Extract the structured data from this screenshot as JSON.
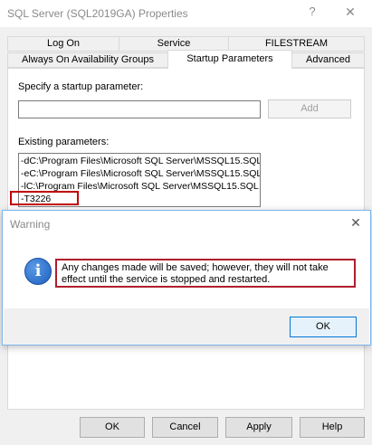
{
  "window": {
    "title": "SQL Server (SQL2019GA) Properties",
    "help_glyph": "?",
    "close_glyph": "✕"
  },
  "tabs": [
    {
      "label": "Log On"
    },
    {
      "label": "Service"
    },
    {
      "label": "FILESTREAM"
    },
    {
      "label": "Always On Availability Groups"
    },
    {
      "label": "Startup Parameters",
      "active": true
    },
    {
      "label": "Advanced"
    }
  ],
  "startup": {
    "specify_label": "Specify a startup parameter:",
    "input_value": "",
    "add_label": "Add",
    "existing_label": "Existing parameters:",
    "parameters": [
      "-dC:\\Program Files\\Microsoft SQL Server\\MSSQL15.SQL",
      "-eC:\\Program Files\\Microsoft SQL Server\\MSSQL15.SQL",
      "-lC:\\Program Files\\Microsoft SQL Server\\MSSQL15.SQL",
      "-T3226"
    ]
  },
  "buttons": {
    "ok": "OK",
    "cancel": "Cancel",
    "apply": "Apply",
    "help": "Help"
  },
  "warning": {
    "title": "Warning",
    "close_glyph": "✕",
    "icon": "info-icon",
    "icon_glyph": "i",
    "message": "Any changes made will be saved; however, they will not take effect until the service is stopped and restarted.",
    "ok_label": "OK"
  },
  "colors": {
    "highlight": "#c00000",
    "info_blue": "#1d5fbf",
    "focus_border": "#0078d7"
  }
}
